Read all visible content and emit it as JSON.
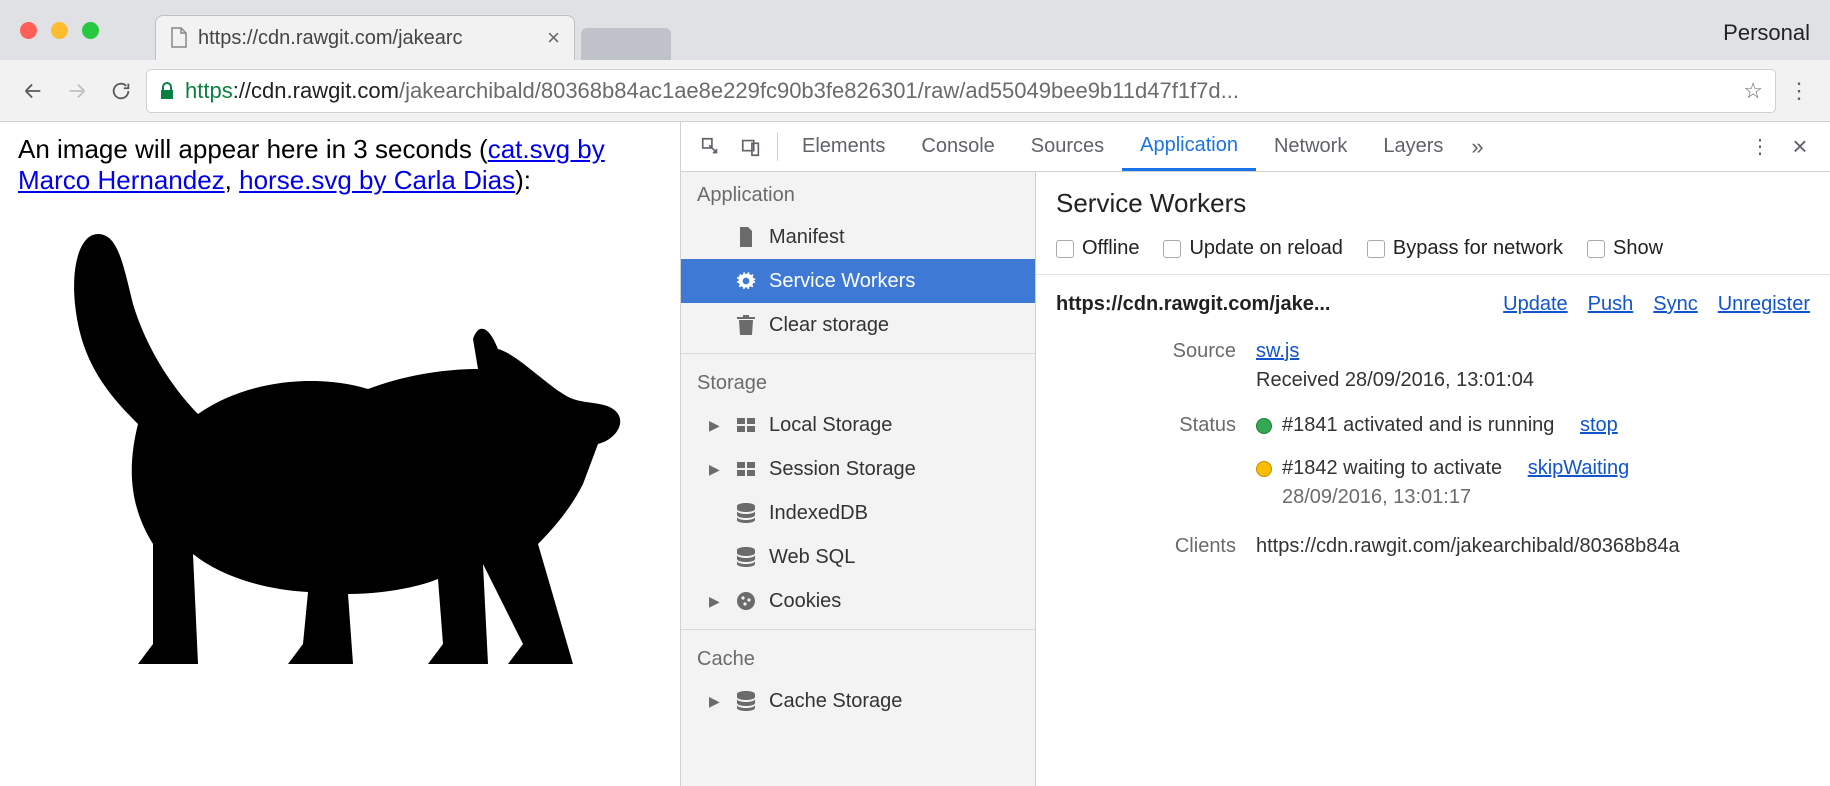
{
  "browser": {
    "profile_label": "Personal",
    "tab_title": "https://cdn.rawgit.com/jakearc",
    "url_protocol": "https",
    "url_host": "://cdn.rawgit.com",
    "url_path": "/jakearchibald/80368b84ac1ae8e229fc90b3fe826301/raw/ad55049bee9b11d47f1f7d..."
  },
  "page": {
    "text_before": "An image will appear here in 3 seconds (",
    "link1": "cat.svg by Marco Hernandez",
    "sep": ", ",
    "link2": "horse.svg by Carla Dias",
    "text_after": "):"
  },
  "devtools": {
    "tabs": {
      "elements": "Elements",
      "console": "Console",
      "sources": "Sources",
      "application": "Application",
      "network": "Network",
      "layers": "Layers"
    }
  },
  "sidebar": {
    "application": "Application",
    "manifest": "Manifest",
    "service_workers": "Service Workers",
    "clear_storage": "Clear storage",
    "storage": "Storage",
    "local_storage": "Local Storage",
    "session_storage": "Session Storage",
    "indexeddb": "IndexedDB",
    "web_sql": "Web SQL",
    "cookies": "Cookies",
    "cache": "Cache",
    "cache_storage": "Cache Storage"
  },
  "panel": {
    "title": "Service Workers",
    "checks": {
      "offline": "Offline",
      "update_on_reload": "Update on reload",
      "bypass": "Bypass for network",
      "show_all": "Show"
    },
    "scope": "https://cdn.rawgit.com/jake...",
    "actions": {
      "update": "Update",
      "push": "Push",
      "sync": "Sync",
      "unregister": "Unregister"
    },
    "labels": {
      "source": "Source",
      "status": "Status",
      "clients": "Clients"
    },
    "source_file": "sw.js",
    "source_received": "Received 28/09/2016, 13:01:04",
    "status1_text": "#1841 activated and is running",
    "status1_action": "stop",
    "status2_text": "#1842 waiting to activate",
    "status2_action": "skipWaiting",
    "status2_time": "28/09/2016, 13:01:17",
    "clients_value": "https://cdn.rawgit.com/jakearchibald/80368b84a"
  }
}
